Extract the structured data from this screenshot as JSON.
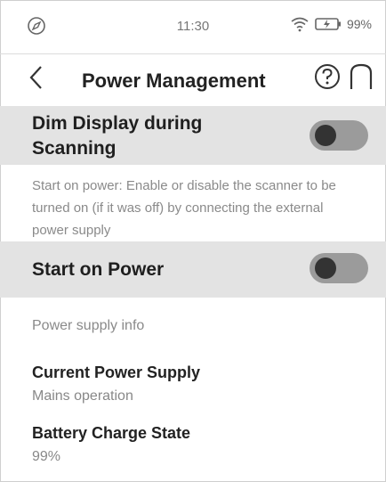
{
  "status": {
    "time": "11:30",
    "battery_percent": "99%"
  },
  "header": {
    "title": "Power Management"
  },
  "settings": {
    "dim_display": {
      "label": "Dim Display during Scanning",
      "enabled": false
    },
    "start_desc": "Start on power: Enable or disable the scanner to be turned on (if it was off) by connecting the external power supply",
    "start_on_power": {
      "label": "Start on Power",
      "enabled": false
    }
  },
  "power_info": {
    "section_title": "Power supply info",
    "current_supply": {
      "label": "Current Power Supply",
      "value": "Mains operation"
    },
    "battery_state": {
      "label": "Battery Charge State",
      "value": "99%"
    }
  },
  "icons": {
    "status": "compass-icon",
    "wifi": "wifi-icon",
    "battery": "battery-charging-icon",
    "back": "chevron-left-icon",
    "help": "help-circle-icon",
    "home": "home-icon"
  },
  "colors": {
    "row_bg": "#e3e3e3",
    "toggle_track": "#9b9b9b",
    "toggle_knob": "#333333"
  }
}
